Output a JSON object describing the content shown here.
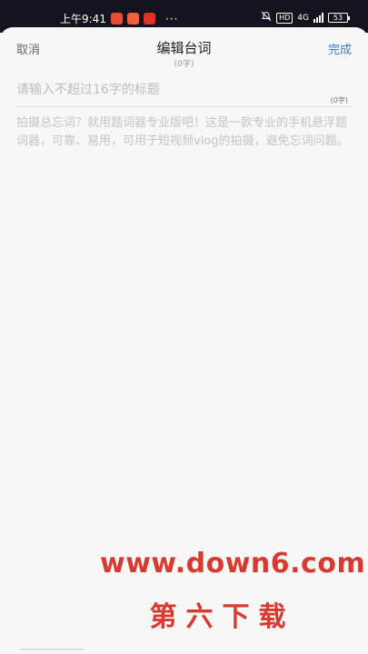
{
  "status_bar": {
    "time": "上午9:41",
    "dots": "···",
    "network": "4G",
    "hd": "HD",
    "battery": "53",
    "app_icon_colors": [
      "#e84a3c",
      "#f0603a",
      "#e0302a"
    ]
  },
  "header": {
    "cancel_label": "取消",
    "title": "编辑台词",
    "char_count": "(0字)",
    "done_label": "完成"
  },
  "title_field": {
    "placeholder": "请输入不超过16字的标题",
    "value": "",
    "char_count": "(0字)"
  },
  "body_field": {
    "placeholder": "拍摄总忘词？就用题词器专业版吧！这是一款专业的手机悬浮题词器，可靠、易用，可用于短视频vlog的拍摄，避免忘词问题。",
    "value": ""
  },
  "watermark": {
    "url": "www.down6.com",
    "name": "第六下载",
    "color": "#d93a30"
  },
  "colors": {
    "accent": "#3a7bd5",
    "status_bar_bg": "#14141e",
    "sheet_bg": "#f7f7f8"
  }
}
